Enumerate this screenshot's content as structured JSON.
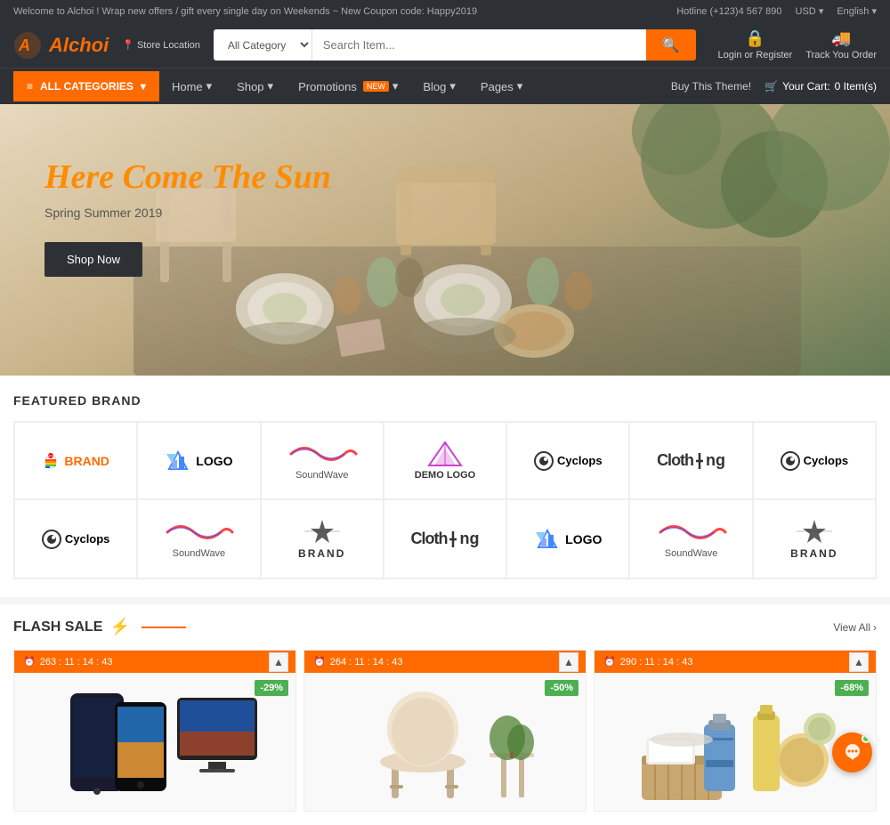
{
  "topbar": {
    "announcement": "Welcome to Alchoi ! Wrap new offers / gift every single day on Weekends ~ New Coupon code: Happy2019",
    "hotline_label": "Hotline (+123)4 567 890",
    "currency": "USD",
    "language": "English"
  },
  "header": {
    "logo_text": "Alchoi",
    "search_placeholder": "Search Item...",
    "category_label": "All Category",
    "login_label": "Login or Register",
    "track_label": "Track You Order",
    "store_label": "Store Location"
  },
  "navbar": {
    "all_categories": "ALL CATEGORIES",
    "links": [
      {
        "label": "Home",
        "has_dropdown": true
      },
      {
        "label": "Shop",
        "has_dropdown": true
      },
      {
        "label": "Promotions",
        "has_dropdown": true,
        "badge": "NEW"
      },
      {
        "label": "Blog",
        "has_dropdown": true
      },
      {
        "label": "Pages",
        "has_dropdown": true
      }
    ],
    "buy_theme": "Buy This Theme!",
    "cart_label": "Your Cart:",
    "cart_items": "0 Item(s)"
  },
  "hero": {
    "title": "Here Come The Sun",
    "subtitle": "Spring Summer 2019",
    "button_label": "Shop Now"
  },
  "brands_section": {
    "title": "FEATURED BRAND",
    "brands": [
      {
        "id": "brand1",
        "type": "apple-rainbow",
        "text": "BRAND"
      },
      {
        "id": "brand2",
        "type": "logo-blue",
        "text": "LOGO"
      },
      {
        "id": "brand3",
        "type": "soundwave",
        "text": "SoundWave"
      },
      {
        "id": "brand4",
        "type": "demo-logo",
        "text": "DEMO LOGO"
      },
      {
        "id": "brand5",
        "type": "cyclops",
        "text": "Cyclops"
      },
      {
        "id": "brand6",
        "type": "clothing",
        "text": "Clothing"
      },
      {
        "id": "brand7",
        "type": "cyclops2",
        "text": "Cyclops"
      },
      {
        "id": "brand8",
        "type": "cyclops3",
        "text": "Cyclops"
      },
      {
        "id": "brand9",
        "type": "soundwave2",
        "text": "SoundWave"
      },
      {
        "id": "brand10",
        "type": "brand-star",
        "text": "BRAND"
      },
      {
        "id": "brand11",
        "type": "clothing2",
        "text": "Clothing"
      },
      {
        "id": "brand12",
        "type": "logo-blue2",
        "text": "LOGO"
      },
      {
        "id": "brand13",
        "type": "soundwave3",
        "text": "SoundWave"
      },
      {
        "id": "brand14",
        "type": "brand-star2",
        "text": "BRAND"
      }
    ]
  },
  "flash_sale": {
    "title": "FLASH SALE",
    "view_all": "View All",
    "products": [
      {
        "timer": "263 : 11 : 14 : 43",
        "discount": "-29%",
        "has_image": true,
        "category": "electronics"
      },
      {
        "timer": "264 : 11 : 14 : 43",
        "discount": "-50%",
        "has_image": true,
        "category": "furniture"
      },
      {
        "timer": "290 : 11 : 14 : 43",
        "discount": "-68%",
        "has_image": true,
        "category": "beauty"
      }
    ]
  },
  "chat": {
    "icon": "💬"
  }
}
